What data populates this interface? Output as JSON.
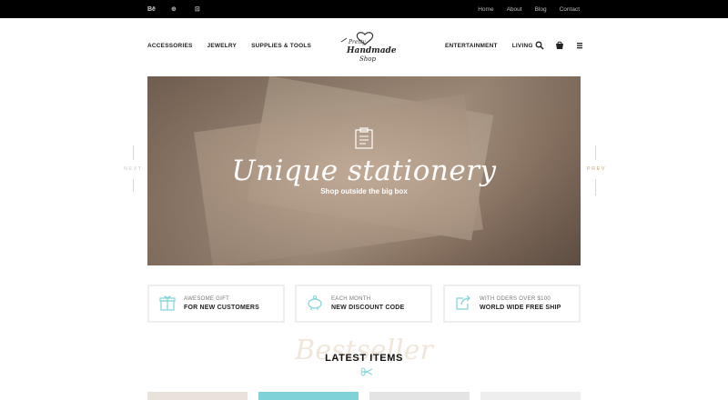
{
  "topbar": {
    "social": [
      "Bē",
      "⊕",
      "⊡"
    ],
    "links": [
      "Home",
      "About",
      "Blog",
      "Contact"
    ]
  },
  "nav": {
    "left": [
      "ACCESSORIES",
      "JEWELRY",
      "SUPPLIES & TOOLS"
    ],
    "right": [
      "ENTERTAINMENT",
      "LIVING"
    ],
    "icons": [
      "search-icon",
      "cart-icon",
      "menu-icon"
    ]
  },
  "logo": {
    "line1": "Pretty",
    "line2": "Handmade",
    "line3": "Shop"
  },
  "hero": {
    "title": "Unique stationery",
    "subtitle": "Shop outside the big box",
    "next": "NEXT",
    "prev": "PREV"
  },
  "features": [
    {
      "top": "AWESOME GIFT",
      "bottom": "FOR NEW CUSTOMERS",
      "icon": "gift-icon"
    },
    {
      "top": "EACH MONTH",
      "bottom": "NEW DISCOUNT CODE",
      "icon": "piggy-bank-icon"
    },
    {
      "top": "WITH ODERS OVER $100",
      "bottom": "WORLD WIDE FREE SHIP",
      "icon": "share-box-icon"
    }
  ],
  "latest": {
    "script": "Bestseller",
    "title": "LATEST ITEMS"
  },
  "colors": {
    "accent": "#7fd3d8",
    "gold": "#caa77a",
    "topbar": "#000000"
  }
}
